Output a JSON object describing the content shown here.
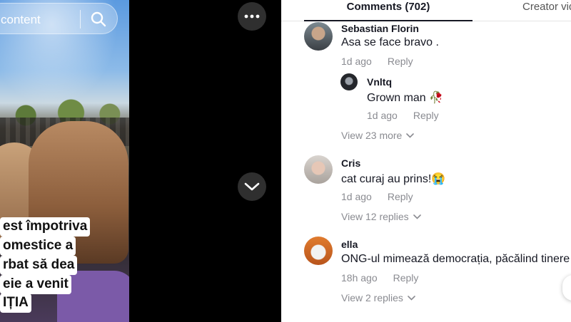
{
  "video": {
    "search_text": "content",
    "caption_lines": [
      "est împotriva",
      "omestice a",
      "rbat să dea",
      "eie a venit",
      "IȚIA"
    ]
  },
  "controls": {
    "more_icon": "ellipsis-icon",
    "next_icon": "chevron-down-icon"
  },
  "tabs": {
    "comments_label": "Comments (702)",
    "creator_label": "Creator vid"
  },
  "comments": [
    {
      "username": "Sebastian Florin",
      "text": "Asa se face bravo .",
      "time": "1d ago",
      "reply_label": "Reply",
      "replies": [
        {
          "username": "Vnltq",
          "text": "Grown man 🥀",
          "time": "1d ago",
          "reply_label": "Reply"
        }
      ],
      "more_label": "View 23 more"
    },
    {
      "username": "Cris",
      "text": "cat curaj au prins!😭",
      "time": "1d ago",
      "reply_label": "Reply",
      "more_label": "View 12 replies"
    },
    {
      "username": "ella",
      "text": "ONG-ul mimează democrația, păcălind tinere",
      "time": "18h ago",
      "reply_label": "Reply",
      "more_label": "View 2 replies"
    }
  ],
  "colors": {
    "text": "#161823",
    "muted": "#8a8b91",
    "dark_button": "#2f2f2f"
  }
}
